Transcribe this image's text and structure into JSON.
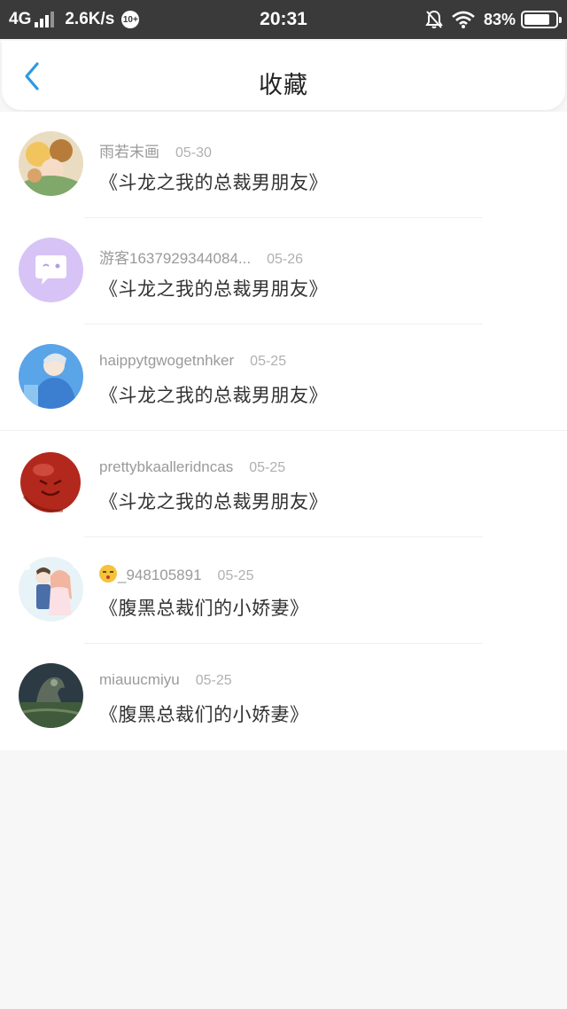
{
  "status_bar": {
    "network": "4G",
    "speed": "2.6K/s",
    "notification_badge": "10+",
    "time": "20:31",
    "battery_percent": "83%",
    "battery_level": 0.83
  },
  "header": {
    "title": "收藏",
    "back_icon": "chevron-left-icon",
    "accent_color": "#2b9ae0"
  },
  "favorites": [
    {
      "user": "雨若末画",
      "date": "05-30",
      "book": "《斗龙之我的总裁男朋友》",
      "avatar": "anime-group"
    },
    {
      "user": "游客1637929344084...",
      "date": "05-26",
      "book": "《斗龙之我的总裁男朋友》",
      "avatar": "default-chat"
    },
    {
      "user": "haippytgwogetnhker",
      "date": "05-25",
      "book": "《斗龙之我的总裁男朋友》",
      "avatar": "anime-boy"
    },
    {
      "user": "prettybkaalleridncas",
      "date": "05-25",
      "book": "《斗龙之我的总裁男朋友》",
      "avatar": "red-ball"
    },
    {
      "user": "_948105891",
      "user_emoji": "kissing-face-emoji",
      "date": "05-25",
      "book": "《腹黑总裁们的小娇妻》",
      "avatar": "anime-couple"
    },
    {
      "user": "miauucmiyu",
      "date": "05-25",
      "book": "《腹黑总裁们的小娇妻》",
      "avatar": "dark-landscape"
    }
  ]
}
